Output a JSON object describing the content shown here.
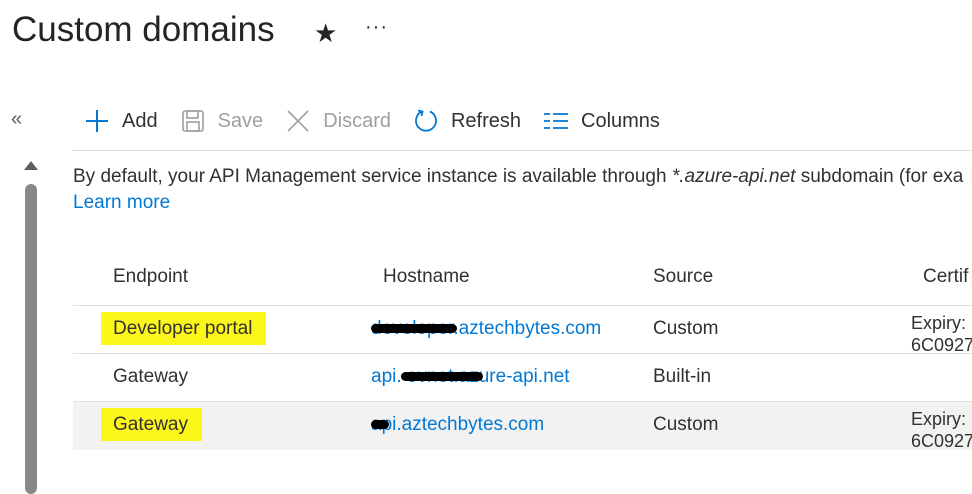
{
  "page": {
    "title": "Custom domains"
  },
  "toolbar": {
    "add": "Add",
    "save": "Save",
    "discard": "Discard",
    "refresh": "Refresh",
    "columns": "Columns"
  },
  "description": {
    "prefix": "By default, your API Management service instance is available through ",
    "domain": "*.azure-api.net",
    "suffix": " subdomain (for exa",
    "learn_more": "Learn more"
  },
  "table": {
    "headers": [
      "Endpoint",
      "Hostname",
      "Source",
      "Certif"
    ],
    "rows": [
      {
        "endpoint": "Developer portal",
        "hostname": "developer.aztechbytes.com",
        "source": "Custom",
        "cert_line1": "Expiry: ",
        "cert_line2": "6C0927",
        "highlighted": true,
        "selected": false
      },
      {
        "endpoint": "Gateway",
        "hostname": "api.                  ovnet.azure-api.net",
        "source": "Built-in",
        "cert_line1": "",
        "cert_line2": "",
        "highlighted": false,
        "selected": false
      },
      {
        "endpoint": "Gateway",
        "hostname": "api.aztechbytes.com",
        "source": "Custom",
        "cert_line1": "Expiry: ",
        "cert_line2": "6C0927",
        "highlighted": true,
        "selected": true
      }
    ]
  },
  "colors": {
    "accent": "#0078d4",
    "highlight": "#fdf61a",
    "disabled": "#a19f9d"
  },
  "icons": [
    "star-icon",
    "more-icon",
    "collapse-icon",
    "add-icon",
    "save-icon",
    "discard-icon",
    "refresh-icon",
    "columns-icon"
  ]
}
